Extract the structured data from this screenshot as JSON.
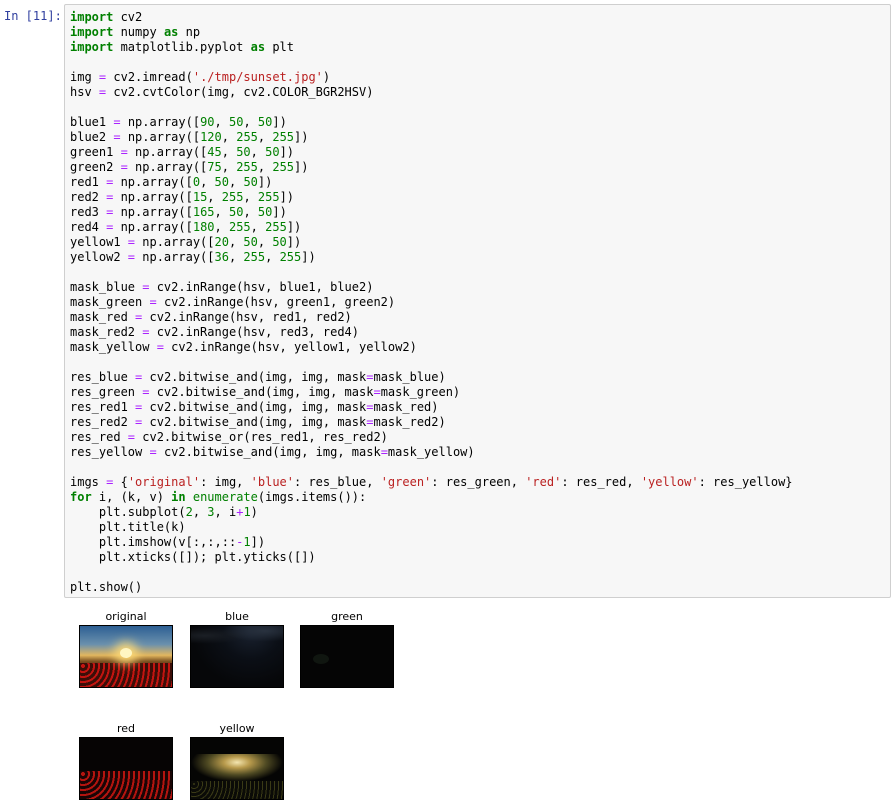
{
  "cell": {
    "prompt": "In [11]:",
    "code_lines": [
      [
        {
          "t": "import",
          "c": "kw"
        },
        {
          "t": " cv2"
        }
      ],
      [
        {
          "t": "import",
          "c": "kw"
        },
        {
          "t": " numpy "
        },
        {
          "t": "as",
          "c": "kw"
        },
        {
          "t": " np"
        }
      ],
      [
        {
          "t": "import",
          "c": "kw"
        },
        {
          "t": " matplotlib.pyplot "
        },
        {
          "t": "as",
          "c": "kw"
        },
        {
          "t": " plt"
        }
      ],
      [],
      [
        {
          "t": "img "
        },
        {
          "t": "=",
          "c": "op"
        },
        {
          "t": " cv2.imread("
        },
        {
          "t": "'./tmp/sunset.jpg'",
          "c": "str"
        },
        {
          "t": ")"
        }
      ],
      [
        {
          "t": "hsv "
        },
        {
          "t": "=",
          "c": "op"
        },
        {
          "t": " cv2.cvtColor(img, cv2.COLOR_BGR2HSV)"
        }
      ],
      [],
      [
        {
          "t": "blue1 "
        },
        {
          "t": "=",
          "c": "op"
        },
        {
          "t": " np.array(["
        },
        {
          "t": "90",
          "c": "num"
        },
        {
          "t": ", "
        },
        {
          "t": "50",
          "c": "num"
        },
        {
          "t": ", "
        },
        {
          "t": "50",
          "c": "num"
        },
        {
          "t": "])"
        }
      ],
      [
        {
          "t": "blue2 "
        },
        {
          "t": "=",
          "c": "op"
        },
        {
          "t": " np.array(["
        },
        {
          "t": "120",
          "c": "num"
        },
        {
          "t": ", "
        },
        {
          "t": "255",
          "c": "num"
        },
        {
          "t": ", "
        },
        {
          "t": "255",
          "c": "num"
        },
        {
          "t": "])"
        }
      ],
      [
        {
          "t": "green1 "
        },
        {
          "t": "=",
          "c": "op"
        },
        {
          "t": " np.array(["
        },
        {
          "t": "45",
          "c": "num"
        },
        {
          "t": ", "
        },
        {
          "t": "50",
          "c": "num"
        },
        {
          "t": ", "
        },
        {
          "t": "50",
          "c": "num"
        },
        {
          "t": "])"
        }
      ],
      [
        {
          "t": "green2 "
        },
        {
          "t": "=",
          "c": "op"
        },
        {
          "t": " np.array(["
        },
        {
          "t": "75",
          "c": "num"
        },
        {
          "t": ", "
        },
        {
          "t": "255",
          "c": "num"
        },
        {
          "t": ", "
        },
        {
          "t": "255",
          "c": "num"
        },
        {
          "t": "])"
        }
      ],
      [
        {
          "t": "red1 "
        },
        {
          "t": "=",
          "c": "op"
        },
        {
          "t": " np.array(["
        },
        {
          "t": "0",
          "c": "num"
        },
        {
          "t": ", "
        },
        {
          "t": "50",
          "c": "num"
        },
        {
          "t": ", "
        },
        {
          "t": "50",
          "c": "num"
        },
        {
          "t": "])"
        }
      ],
      [
        {
          "t": "red2 "
        },
        {
          "t": "=",
          "c": "op"
        },
        {
          "t": " np.array(["
        },
        {
          "t": "15",
          "c": "num"
        },
        {
          "t": ", "
        },
        {
          "t": "255",
          "c": "num"
        },
        {
          "t": ", "
        },
        {
          "t": "255",
          "c": "num"
        },
        {
          "t": "])"
        }
      ],
      [
        {
          "t": "red3 "
        },
        {
          "t": "=",
          "c": "op"
        },
        {
          "t": " np.array(["
        },
        {
          "t": "165",
          "c": "num"
        },
        {
          "t": ", "
        },
        {
          "t": "50",
          "c": "num"
        },
        {
          "t": ", "
        },
        {
          "t": "50",
          "c": "num"
        },
        {
          "t": "])"
        }
      ],
      [
        {
          "t": "red4 "
        },
        {
          "t": "=",
          "c": "op"
        },
        {
          "t": " np.array(["
        },
        {
          "t": "180",
          "c": "num"
        },
        {
          "t": ", "
        },
        {
          "t": "255",
          "c": "num"
        },
        {
          "t": ", "
        },
        {
          "t": "255",
          "c": "num"
        },
        {
          "t": "])"
        }
      ],
      [
        {
          "t": "yellow1 "
        },
        {
          "t": "=",
          "c": "op"
        },
        {
          "t": " np.array(["
        },
        {
          "t": "20",
          "c": "num"
        },
        {
          "t": ", "
        },
        {
          "t": "50",
          "c": "num"
        },
        {
          "t": ", "
        },
        {
          "t": "50",
          "c": "num"
        },
        {
          "t": "])"
        }
      ],
      [
        {
          "t": "yellow2 "
        },
        {
          "t": "=",
          "c": "op"
        },
        {
          "t": " np.array(["
        },
        {
          "t": "36",
          "c": "num"
        },
        {
          "t": ", "
        },
        {
          "t": "255",
          "c": "num"
        },
        {
          "t": ", "
        },
        {
          "t": "255",
          "c": "num"
        },
        {
          "t": "])"
        }
      ],
      [],
      [
        {
          "t": "mask_blue "
        },
        {
          "t": "=",
          "c": "op"
        },
        {
          "t": " cv2.inRange(hsv, blue1, blue2)"
        }
      ],
      [
        {
          "t": "mask_green "
        },
        {
          "t": "=",
          "c": "op"
        },
        {
          "t": " cv2.inRange(hsv, green1, green2)"
        }
      ],
      [
        {
          "t": "mask_red "
        },
        {
          "t": "=",
          "c": "op"
        },
        {
          "t": " cv2.inRange(hsv, red1, red2)"
        }
      ],
      [
        {
          "t": "mask_red2 "
        },
        {
          "t": "=",
          "c": "op"
        },
        {
          "t": " cv2.inRange(hsv, red3, red4)"
        }
      ],
      [
        {
          "t": "mask_yellow "
        },
        {
          "t": "=",
          "c": "op"
        },
        {
          "t": " cv2.inRange(hsv, yellow1, yellow2)"
        }
      ],
      [],
      [
        {
          "t": "res_blue "
        },
        {
          "t": "=",
          "c": "op"
        },
        {
          "t": " cv2.bitwise_and(img, img, mask"
        },
        {
          "t": "=",
          "c": "op"
        },
        {
          "t": "mask_blue)"
        }
      ],
      [
        {
          "t": "res_green "
        },
        {
          "t": "=",
          "c": "op"
        },
        {
          "t": " cv2.bitwise_and(img, img, mask"
        },
        {
          "t": "=",
          "c": "op"
        },
        {
          "t": "mask_green)"
        }
      ],
      [
        {
          "t": "res_red1 "
        },
        {
          "t": "=",
          "c": "op"
        },
        {
          "t": " cv2.bitwise_and(img, img, mask"
        },
        {
          "t": "=",
          "c": "op"
        },
        {
          "t": "mask_red)"
        }
      ],
      [
        {
          "t": "res_red2 "
        },
        {
          "t": "=",
          "c": "op"
        },
        {
          "t": " cv2.bitwise_and(img, img, mask"
        },
        {
          "t": "=",
          "c": "op"
        },
        {
          "t": "mask_red2)"
        }
      ],
      [
        {
          "t": "res_red "
        },
        {
          "t": "=",
          "c": "op"
        },
        {
          "t": " cv2.bitwise_or(res_red1, res_red2)"
        }
      ],
      [
        {
          "t": "res_yellow "
        },
        {
          "t": "=",
          "c": "op"
        },
        {
          "t": " cv2.bitwise_and(img, img, mask"
        },
        {
          "t": "=",
          "c": "op"
        },
        {
          "t": "mask_yellow)"
        }
      ],
      [],
      [
        {
          "t": "imgs "
        },
        {
          "t": "=",
          "c": "op"
        },
        {
          "t": " {"
        },
        {
          "t": "'original'",
          "c": "str"
        },
        {
          "t": ": img, "
        },
        {
          "t": "'blue'",
          "c": "str"
        },
        {
          "t": ": res_blue, "
        },
        {
          "t": "'green'",
          "c": "str"
        },
        {
          "t": ": res_green, "
        },
        {
          "t": "'red'",
          "c": "str"
        },
        {
          "t": ": res_red, "
        },
        {
          "t": "'yellow'",
          "c": "str"
        },
        {
          "t": ": res_yellow}"
        }
      ],
      [
        {
          "t": "for",
          "c": "kw"
        },
        {
          "t": " i, (k, v) "
        },
        {
          "t": "in",
          "c": "kw"
        },
        {
          "t": " "
        },
        {
          "t": "enumerate",
          "c": "bi"
        },
        {
          "t": "(imgs.items()):"
        }
      ],
      [
        {
          "t": "    plt.subplot("
        },
        {
          "t": "2",
          "c": "num"
        },
        {
          "t": ", "
        },
        {
          "t": "3",
          "c": "num"
        },
        {
          "t": ", i"
        },
        {
          "t": "+",
          "c": "op"
        },
        {
          "t": "1",
          "c": "num"
        },
        {
          "t": ")"
        }
      ],
      [
        {
          "t": "    plt.title(k)"
        }
      ],
      [
        {
          "t": "    plt.imshow(v[:,:,::"
        },
        {
          "t": "-",
          "c": "op"
        },
        {
          "t": "1",
          "c": "num"
        },
        {
          "t": "])"
        }
      ],
      [
        {
          "t": "    plt.xticks([]); plt.yticks([])"
        }
      ],
      [],
      [
        {
          "t": "plt.show()"
        }
      ]
    ]
  },
  "output": {
    "subplots": [
      {
        "title": "original",
        "kind": "original"
      },
      {
        "title": "blue",
        "kind": "blue"
      },
      {
        "title": "green",
        "kind": "green"
      },
      {
        "title": "red",
        "kind": "red"
      },
      {
        "title": "yellow",
        "kind": "yellow"
      }
    ]
  }
}
